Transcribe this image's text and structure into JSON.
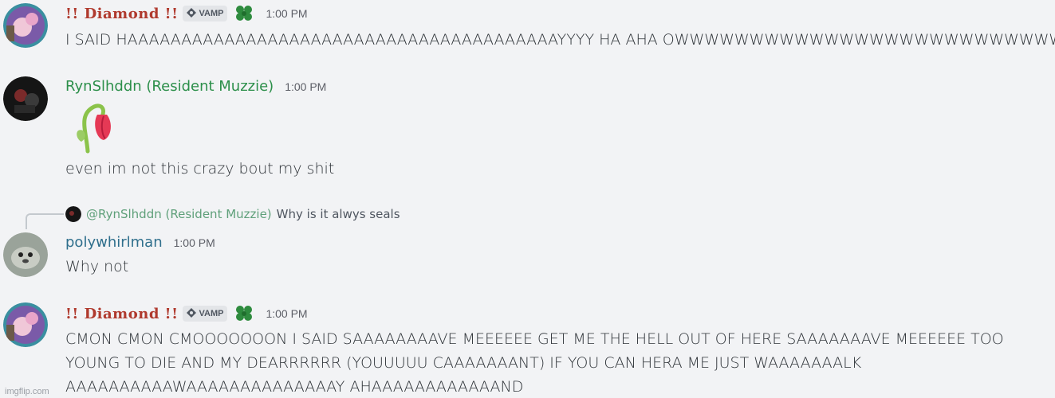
{
  "messages": [
    {
      "author": "!! Diamond !!",
      "tag": "VAMP",
      "time": "1:00 PM",
      "lines": [
        "I SAID HAAAAAAAAAAAAAAAAAAAAAAAAAAAAAAAAAAAAAAAAYYYY HA AHA OWWWWWWWWWWWWWWWWWWWWWWWWWWWW"
      ]
    },
    {
      "author": "RynSlhddn (Resident Muzzie)",
      "time": "1:00 PM",
      "lines": [
        "even im not this crazy bout my shit"
      ]
    },
    {
      "reply_mention": "@RynSlhddn (Resident Muzzie)",
      "reply_snippet": "Why is it alwys seals",
      "author": "polywhirlman",
      "time": "1:00 PM",
      "lines": [
        "Why not"
      ]
    },
    {
      "author": "!! Diamond !!",
      "tag": "VAMP",
      "time": "1:00 PM",
      "lines": [
        "CMON CMON CMOOOOOOON I SAID SAAAAAAAAVE MEEEEEE GET ME THE HELL OUT OF HERE SAAAAAAAVE MEEEEEE TOO",
        "YOUNG TO DIE AND MY DEARRRRRR (YOUUUUU CAAAAAAANT) IF YOU CAN HERA ME JUST WAAAAAAALK",
        "AAAAAAAAAAWAAAAAAAAAAAAAAY AHAAAAAAAAAAAAND"
      ]
    }
  ],
  "watermark": "imgflip.com",
  "icons": [
    "vamp-badge-icon",
    "clover-icon",
    "wilted-rose-emoji"
  ],
  "colors": {
    "background": "#f2f3f5",
    "diamond": "#b03a2e",
    "ryn": "#2c8f4a",
    "poly": "#2f6f8c"
  }
}
